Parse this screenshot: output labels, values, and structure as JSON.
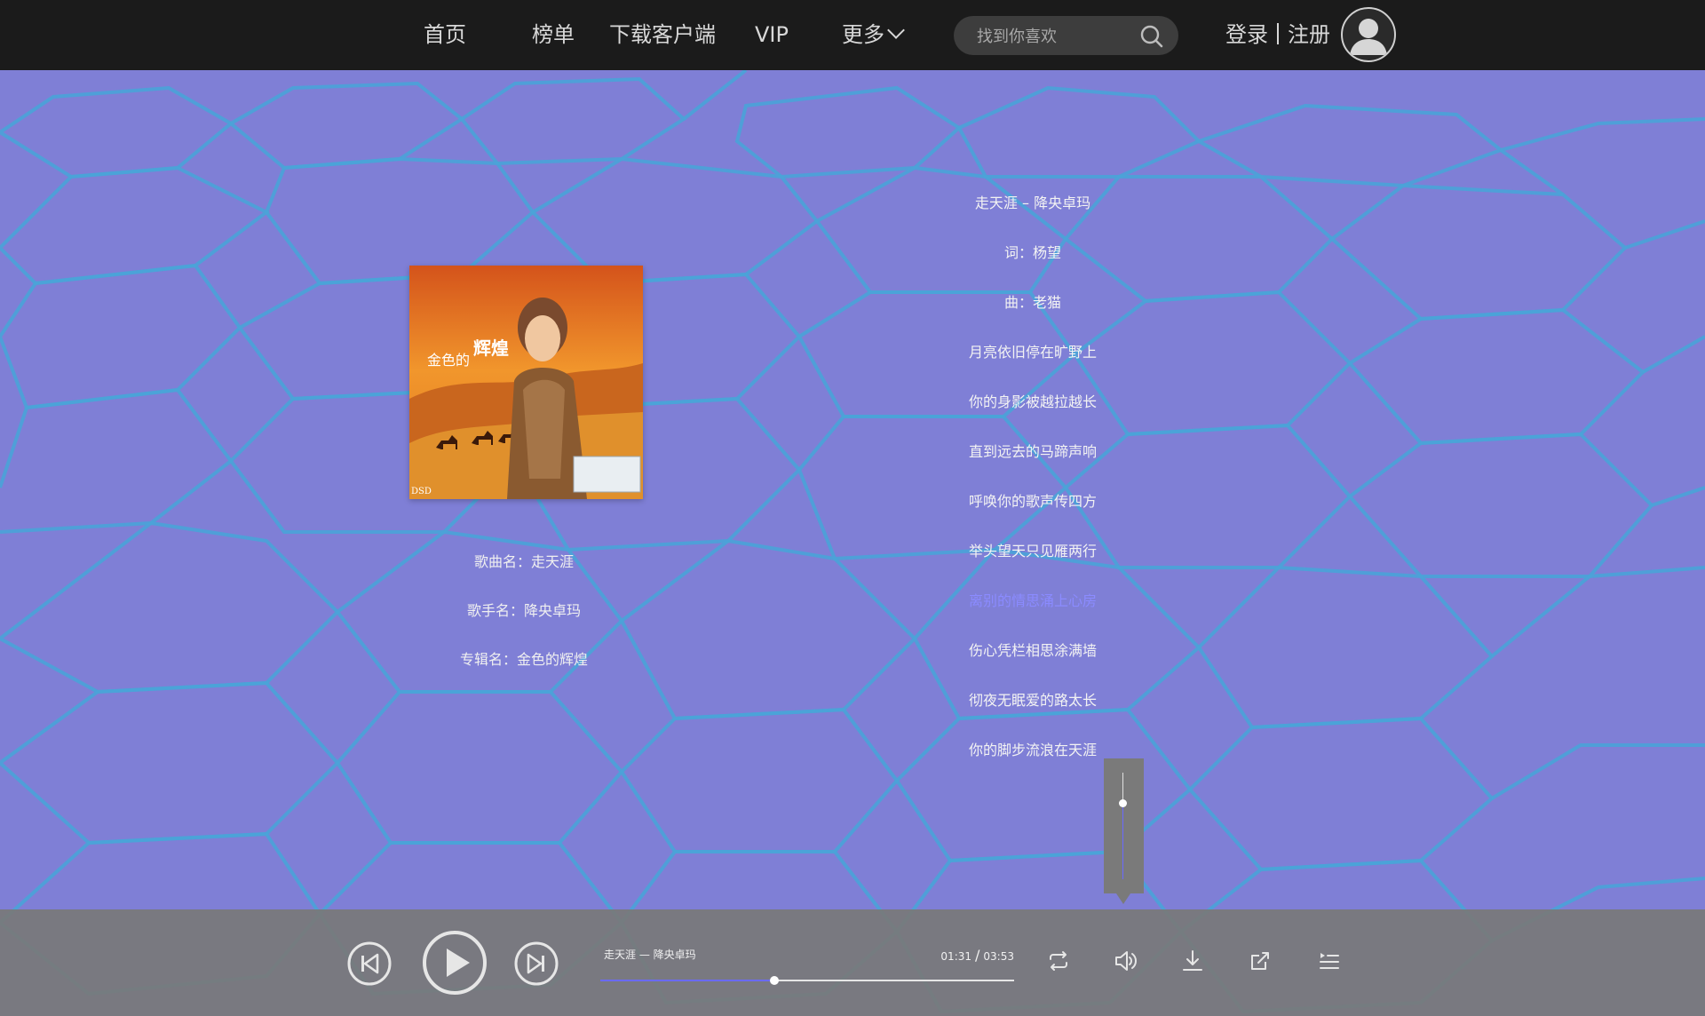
{
  "nav": {
    "home": "首页",
    "charts": "榜单",
    "download_client": "下载客户端",
    "vip": "VIP",
    "more": "更多",
    "search_placeholder": "找到你喜欢",
    "login": "登录",
    "register": "注册"
  },
  "song_info": {
    "name_label": "歌曲名：",
    "name": "走天涯",
    "singer_label": "歌手名：",
    "singer": "降央卓玛",
    "album_label": "专辑名：",
    "album": "金色的辉煌"
  },
  "album_cover": {
    "title_big": "辉煌",
    "title_small": "金色的",
    "label": "DSD"
  },
  "lyrics": [
    {
      "text": "走天涯 – 降央卓玛",
      "active": false
    },
    {
      "text": "词：杨望",
      "active": false
    },
    {
      "text": "曲：老猫",
      "active": false
    },
    {
      "text": "月亮依旧停在旷野上",
      "active": false
    },
    {
      "text": "你的身影被越拉越长",
      "active": false
    },
    {
      "text": "直到远去的马蹄声响",
      "active": false
    },
    {
      "text": "呼唤你的歌声传四方",
      "active": false
    },
    {
      "text": "举头望天只见雁两行",
      "active": false
    },
    {
      "text": "离别的情思涌上心房",
      "active": true
    },
    {
      "text": "伤心凭栏相思涂满墙",
      "active": false
    },
    {
      "text": "彻夜无眠爱的路太长",
      "active": false
    },
    {
      "text": "你的脚步流浪在天涯",
      "active": false
    }
  ],
  "player": {
    "track_title": "走天涯 — 降央卓玛",
    "current_time": "01:31",
    "total_time": "03:53",
    "progress": 0.42,
    "volume": 0.72,
    "accent_color": "#6a6aff"
  },
  "colors": {
    "background": "#7f7fd6",
    "network_line": "#4aa3d8",
    "topbar": "#1b1b1b"
  }
}
